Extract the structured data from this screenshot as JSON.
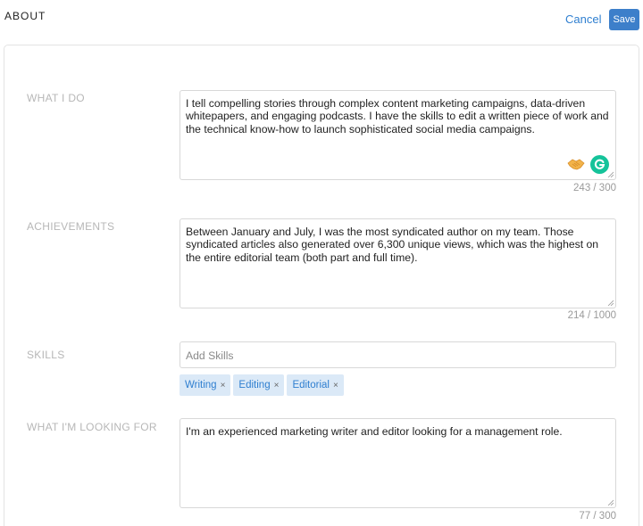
{
  "header": {
    "title": "ABOUT",
    "cancel_label": "Cancel",
    "save_label": "Save"
  },
  "sections": {
    "what_i_do": {
      "label": "WHAT I DO",
      "value": "I tell compelling stories through complex content marketing campaigns, data-driven whitepapers, and engaging podcasts. I have the skills to edit a written piece of work and the technical know-how to launch sophisticated social media campaigns.",
      "counter": "243 / 300"
    },
    "achievements": {
      "label": "ACHIEVEMENTS",
      "value": "Between January and July, I was the most syndicated author on my team. Those syndicated articles also generated over 6,300 unique views, which was the highest on the entire editorial team (both part and full time).",
      "counter": "214 / 1000"
    },
    "skills": {
      "label": "SKILLS",
      "placeholder": "Add Skills",
      "chips": [
        {
          "label": "Writing",
          "remove": "×"
        },
        {
          "label": "Editing",
          "remove": "×"
        },
        {
          "label": "Editorial",
          "remove": "×"
        }
      ]
    },
    "looking_for": {
      "label": "WHAT I'M LOOKING FOR",
      "value": "I'm an experienced marketing writer and editor looking for a management role.",
      "counter": "77 / 300"
    }
  },
  "icons": {
    "emoji": "handshake-emoji-icon",
    "grammarly": "grammarly-icon",
    "accent_color": "#2f7fd0",
    "grammarly_color": "#15c39a"
  }
}
